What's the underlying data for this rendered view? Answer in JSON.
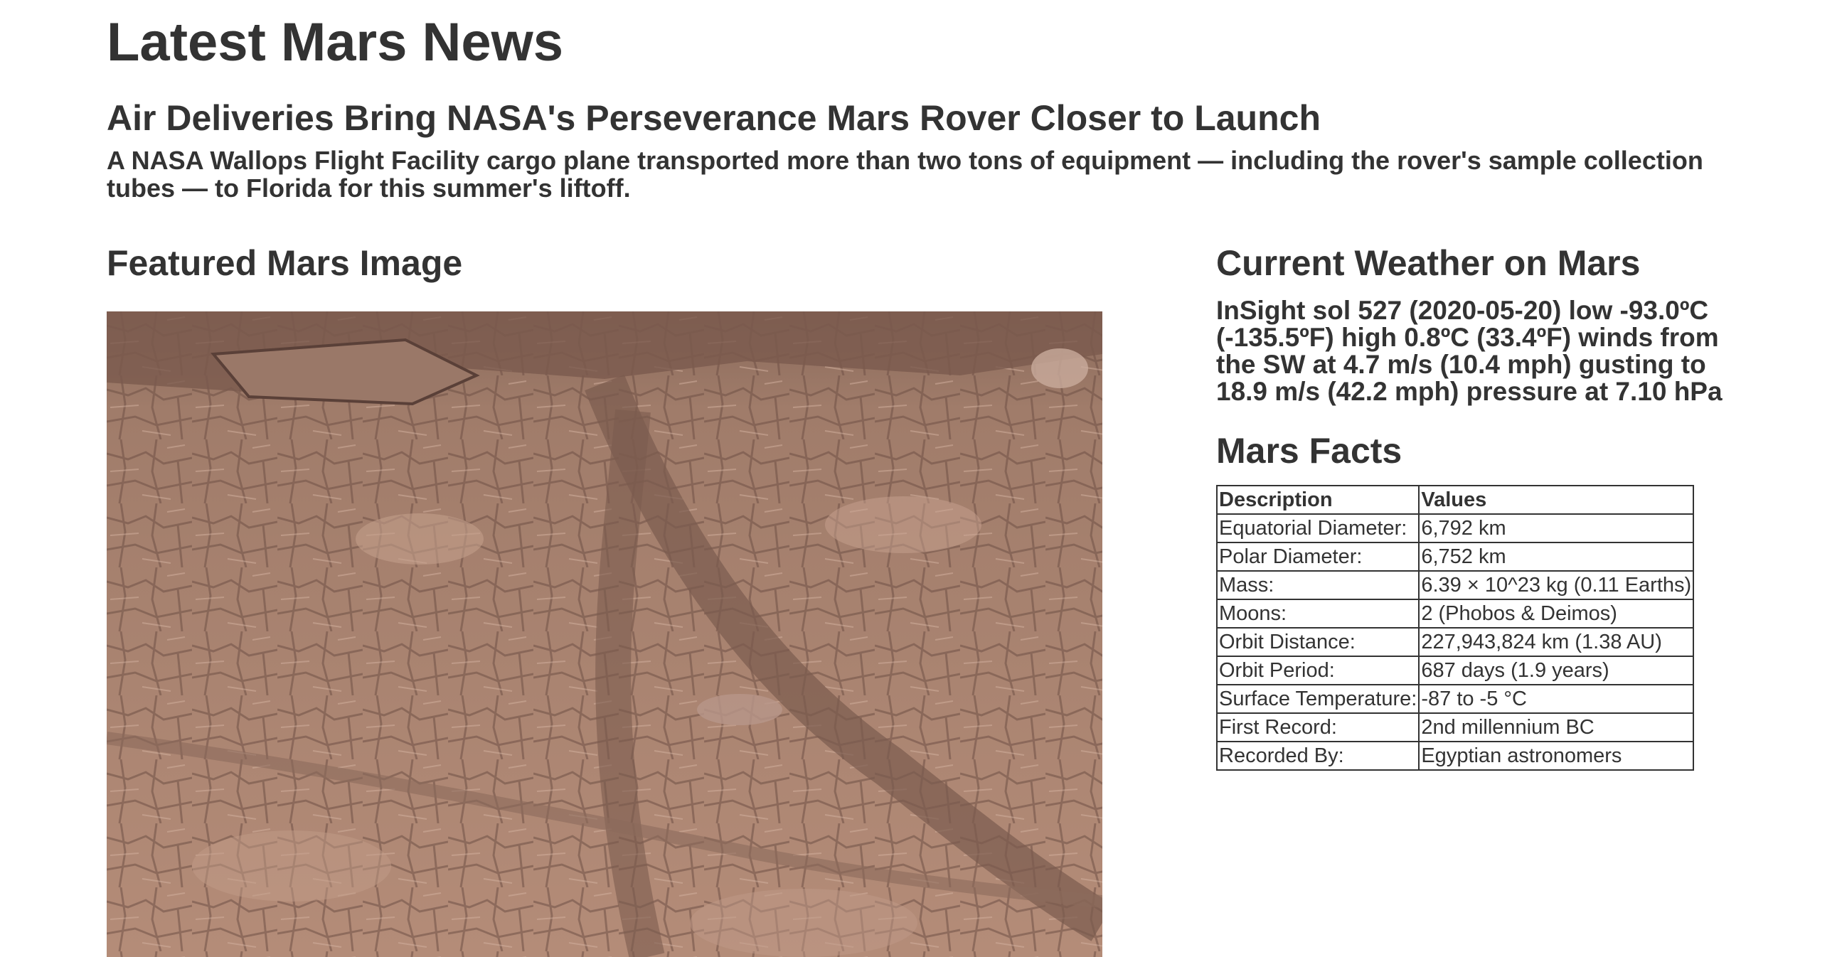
{
  "page": {
    "title": "Latest Mars News"
  },
  "news": {
    "title": "Air Deliveries Bring NASA's Perseverance Mars Rover Closer to Launch",
    "teaser": "A NASA Wallops Flight Facility cargo plane transported more than two tons of equipment — including the rover's sample collection tubes — to Florida for this summer's liftoff."
  },
  "featured_image": {
    "heading": "Featured Mars Image",
    "subject": "Martian cracked rocky terrain photograph"
  },
  "weather": {
    "heading": "Current Weather on Mars",
    "report": "InSight sol 527 (2020-05-20) low -93.0ºC (-135.5ºF) high 0.8ºC (33.4ºF) winds from the SW at 4.7 m/s (10.4 mph) gusting to 18.9 m/s (42.2 mph) pressure at 7.10 hPa"
  },
  "facts": {
    "heading": "Mars Facts",
    "columns": [
      "Description",
      "Values"
    ],
    "rows": [
      [
        "Equatorial Diameter:",
        "6,792 km"
      ],
      [
        "Polar Diameter:",
        "6,752 km"
      ],
      [
        "Mass:",
        "6.39 × 10^23 kg (0.11 Earths)"
      ],
      [
        "Moons:",
        "2 (Phobos & Deimos)"
      ],
      [
        "Orbit Distance:",
        "227,943,824 km (1.38 AU)"
      ],
      [
        "Orbit Period:",
        "687 days (1.9 years)"
      ],
      [
        "Surface Temperature:",
        "-87 to -5 °C"
      ],
      [
        "First Record:",
        "2nd millennium BC"
      ],
      [
        "Recorded By:",
        "Egyptian astronomers"
      ]
    ]
  },
  "colors": {
    "text": "#333333",
    "background": "#ffffff",
    "terrain": "#a9826f"
  }
}
